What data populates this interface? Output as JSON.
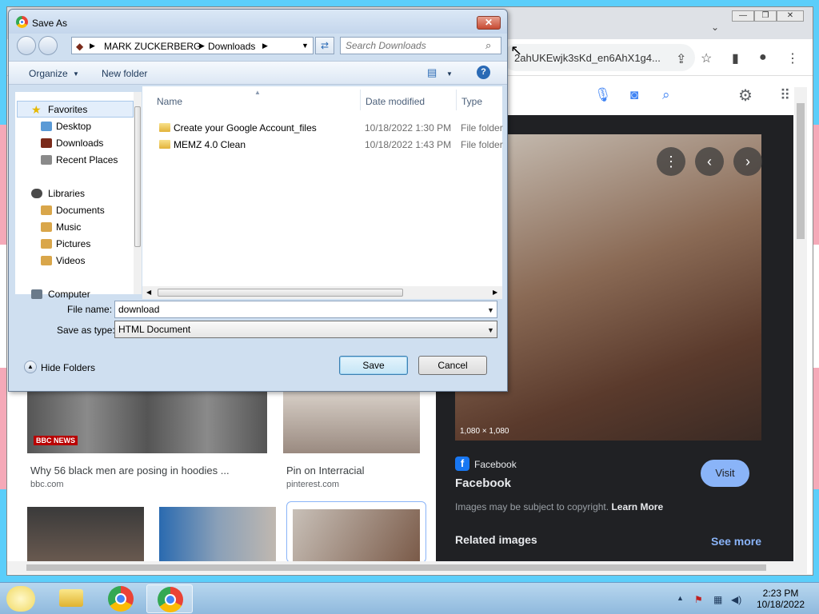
{
  "browser": {
    "url_fragment": "2ahUKEwjk3sKd_en6AhX1g4...",
    "results": [
      {
        "title": "Why 56 black men are posing in hoodies ...",
        "site": "bbc.com",
        "badge": "BBC NEWS"
      },
      {
        "title": "Pin on Interracial",
        "site": "pinterest.com"
      }
    ],
    "panel": {
      "dimensions": "1,080 × 1,080",
      "source_small": "Facebook",
      "source_big": "Facebook",
      "visit_label": "Visit",
      "copyright_text": "Images may be subject to copyright.",
      "learn_more": "Learn More",
      "related_label": "Related images",
      "see_more": "See more"
    }
  },
  "dialog": {
    "title": "Save As",
    "breadcrumb": [
      "MARK ZUCKERBERG",
      "Downloads"
    ],
    "search_placeholder": "Search Downloads",
    "commands": {
      "organize": "Organize",
      "new_folder": "New folder"
    },
    "nav": {
      "favorites": "Favorites",
      "desktop": "Desktop",
      "downloads": "Downloads",
      "recent": "Recent Places",
      "libraries": "Libraries",
      "documents": "Documents",
      "music": "Music",
      "pictures": "Pictures",
      "videos": "Videos",
      "computer": "Computer"
    },
    "columns": {
      "name": "Name",
      "date": "Date modified",
      "type": "Type"
    },
    "files": [
      {
        "name": "Create your Google Account_files",
        "date": "10/18/2022 1:30 PM",
        "type": "File folder"
      },
      {
        "name": "MEMZ 4.0 Clean",
        "date": "10/18/2022 1:43 PM",
        "type": "File folder"
      }
    ],
    "file_name_label": "File name:",
    "file_name_value": "download",
    "save_type_label": "Save as type:",
    "save_type_value": "HTML Document",
    "hide_folders": "Hide Folders",
    "save_label": "Save",
    "cancel_label": "Cancel"
  },
  "taskbar": {
    "time": "2:23 PM",
    "date": "10/18/2022"
  },
  "colors": {
    "trans_blue": "#5bcefa",
    "trans_pink": "#f5a9b8",
    "google_blue": "#8ab4f8",
    "panel_dark": "#202124"
  }
}
